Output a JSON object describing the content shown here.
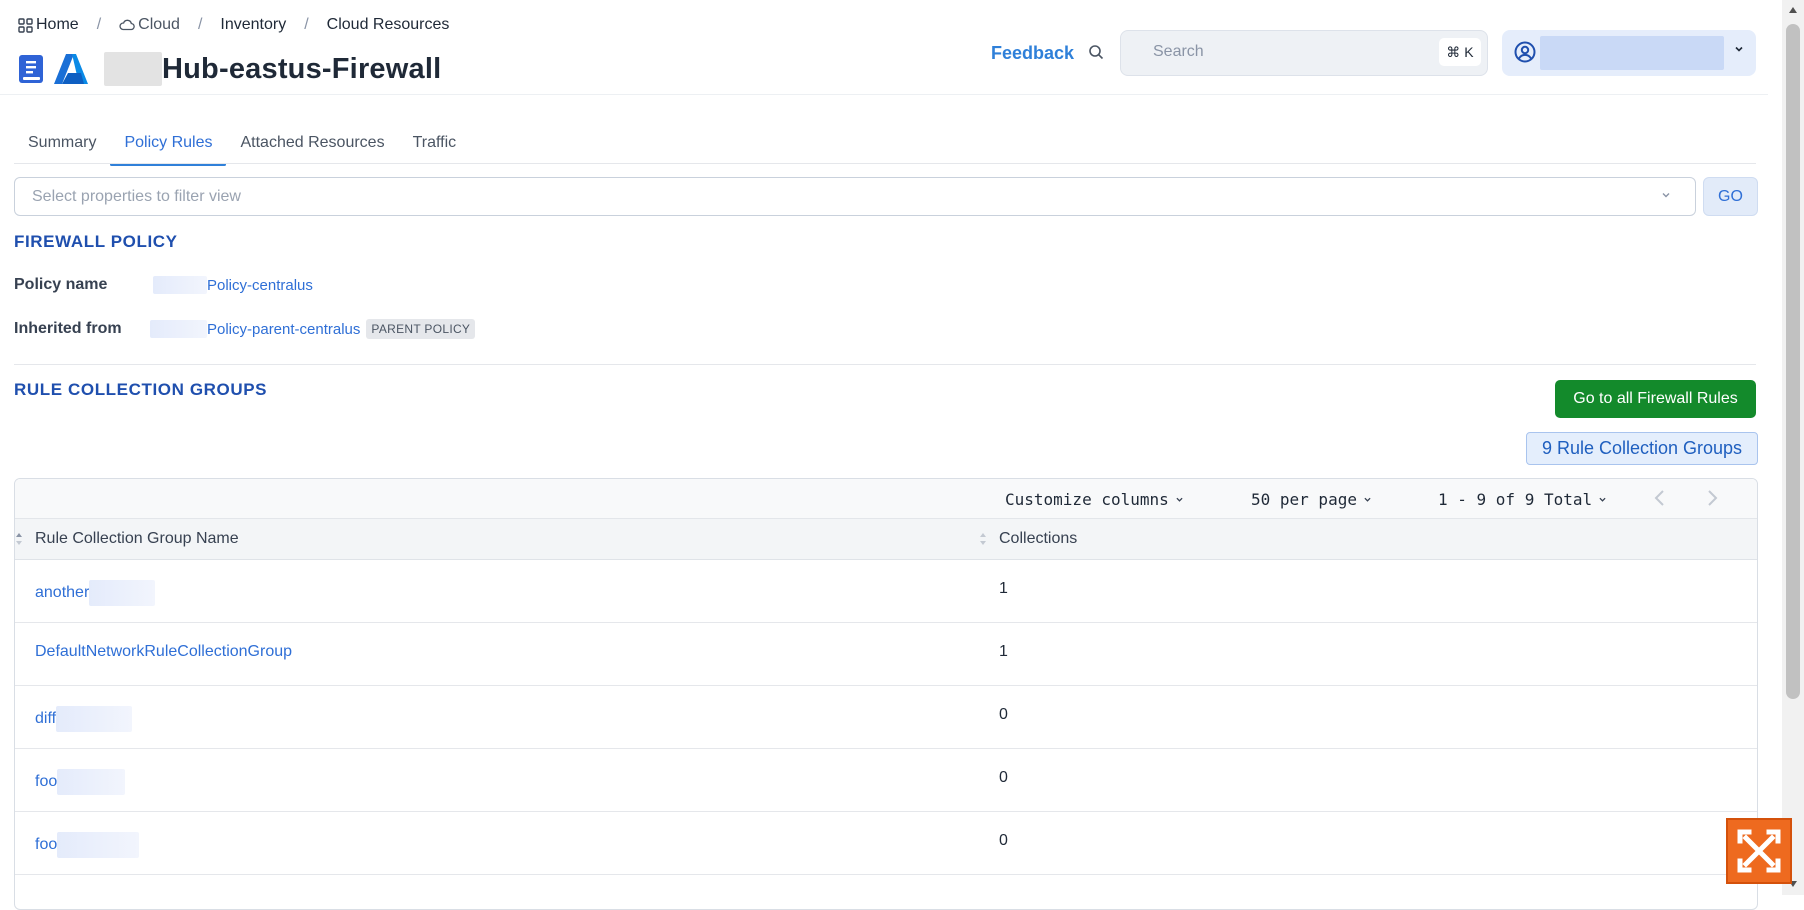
{
  "breadcrumb": [
    {
      "label": "Home",
      "icon": "grid-icon"
    },
    {
      "label": "Cloud",
      "icon": "cloud-icon"
    },
    {
      "label": "Inventory"
    },
    {
      "label": "Cloud Resources"
    }
  ],
  "page": {
    "title": "Hub-eastus-Firewall"
  },
  "header": {
    "feedback_label": "Feedback",
    "search_placeholder": "Search",
    "search_shortcut": "⌘ K"
  },
  "tabs": [
    {
      "label": "Summary",
      "active": false
    },
    {
      "label": "Policy Rules",
      "active": true
    },
    {
      "label": "Attached Resources",
      "active": false
    },
    {
      "label": "Traffic",
      "active": false
    }
  ],
  "filter": {
    "placeholder": "Select properties to filter view",
    "go_label": "GO"
  },
  "firewall_policy": {
    "heading": "FIREWALL POLICY",
    "policy_name_label": "Policy name",
    "policy_name_value": "Policy-centralus",
    "inherited_label": "Inherited from",
    "inherited_value": "Policy-parent-centralus",
    "inherited_badge": "PARENT POLICY"
  },
  "rule_groups": {
    "heading": "RULE COLLECTION GROUPS",
    "go_all_label": "Go to all Firewall Rules",
    "count_label": "9 Rule Collection Groups"
  },
  "table": {
    "customize_label": "Customize columns",
    "per_page_label": "50 per page",
    "pagination_label": "1 - 9 of 9 Total",
    "columns": [
      "Rule Collection Group Name",
      "Collections"
    ],
    "rows": [
      {
        "name": "another",
        "collections": "1"
      },
      {
        "name": "DefaultNetworkRuleCollectionGroup",
        "collections": "1"
      },
      {
        "name": "diff",
        "collections": "0"
      },
      {
        "name": "foo",
        "collections": "0"
      },
      {
        "name": "foo",
        "collections": "0"
      }
    ]
  },
  "colors": {
    "accent": "#2f6fd6",
    "heading": "#1f4fae",
    "green": "#138a2b",
    "brand_orange": "#ee6a1f"
  }
}
